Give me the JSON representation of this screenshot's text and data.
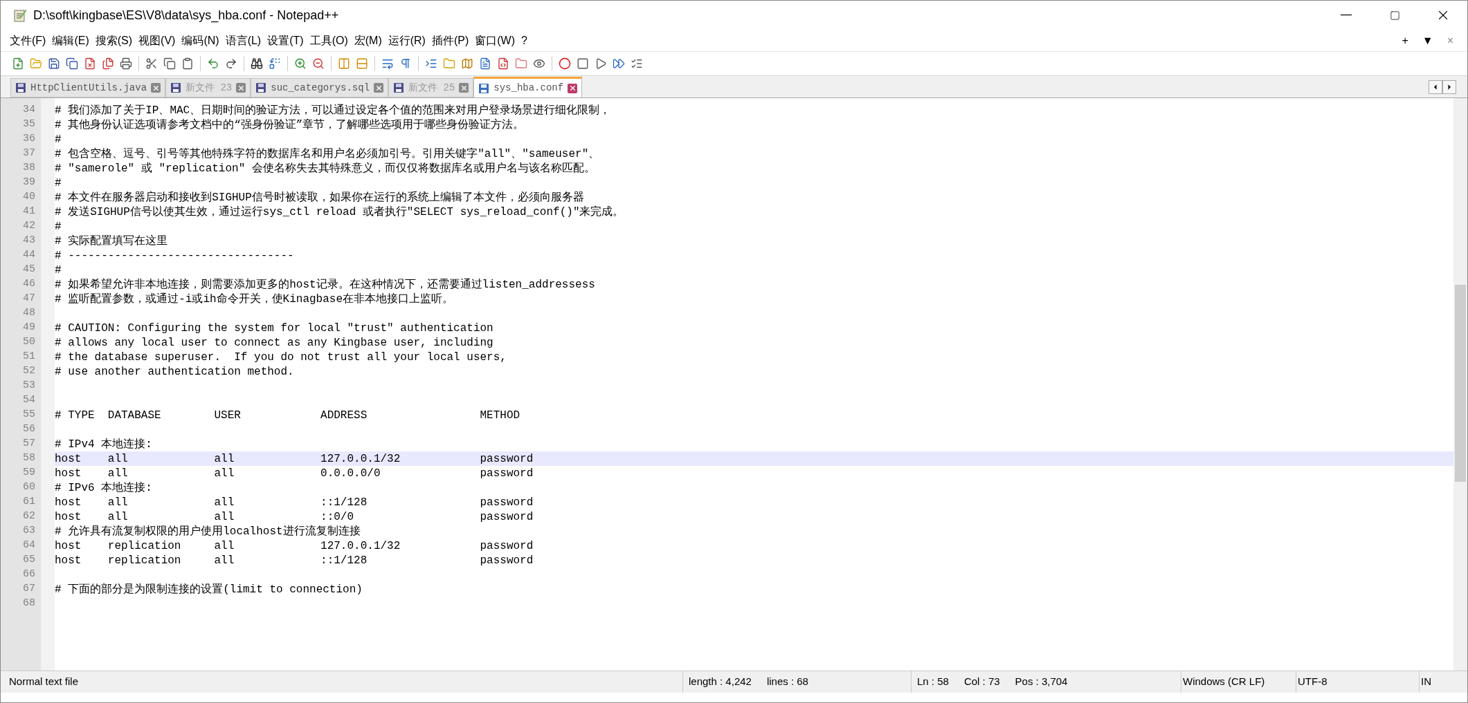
{
  "window": {
    "title": "D:\\soft\\kingbase\\ES\\V8\\data\\sys_hba.conf - Notepad++"
  },
  "menu": [
    "文件(F)",
    "编辑(E)",
    "搜索(S)",
    "视图(V)",
    "编码(N)",
    "语言(L)",
    "设置(T)",
    "工具(O)",
    "宏(M)",
    "运行(R)",
    "插件(P)",
    "窗口(W)",
    "?"
  ],
  "menu_right": [
    "+",
    "▼",
    "×"
  ],
  "tabs": [
    {
      "label": "HttpClientUtils.java",
      "selected": false,
      "dimmed": false
    },
    {
      "label": "新文件 23",
      "selected": false,
      "dimmed": true
    },
    {
      "label": "suc_categorys.sql",
      "selected": false,
      "dimmed": false
    },
    {
      "label": "新文件 25",
      "selected": false,
      "dimmed": true
    },
    {
      "label": "sys_hba.conf",
      "selected": true,
      "dimmed": false
    }
  ],
  "lines": [
    {
      "number": "34",
      "text": "# 我们添加了关于IP、MAC、日期时间的验证方法，可以通过设定各个值的范围来对用户登录场景进行细化限制，",
      "current": false
    },
    {
      "number": "35",
      "text": "# 其他身份认证选项请参考文档中的“强身份验证”章节，了解哪些选项用于哪些身份验证方法。",
      "current": false
    },
    {
      "number": "36",
      "text": "#",
      "current": false
    },
    {
      "number": "37",
      "text": "# 包含空格、逗号、引号等其他特殊字符的数据库名和用户名必须加引号。引用关键字\"all\"、\"sameuser\"、",
      "current": false
    },
    {
      "number": "38",
      "text": "# \"samerole\" 或 \"replication\" 会使名称失去其特殊意义，而仅仅将数据库名或用户名与该名称匹配。",
      "current": false
    },
    {
      "number": "39",
      "text": "#",
      "current": false
    },
    {
      "number": "40",
      "text": "# 本文件在服务器启动和接收到SIGHUP信号时被读取，如果你在运行的系统上编辑了本文件，必须向服务器",
      "current": false
    },
    {
      "number": "41",
      "text": "# 发送SIGHUP信号以使其生效，通过运行sys_ctl reload 或者执行\"SELECT sys_reload_conf()\"来完成。",
      "current": false
    },
    {
      "number": "42",
      "text": "#",
      "current": false
    },
    {
      "number": "43",
      "text": "# 实际配置填写在这里",
      "current": false
    },
    {
      "number": "44",
      "text": "# ----------------------------------",
      "current": false
    },
    {
      "number": "45",
      "text": "#",
      "current": false
    },
    {
      "number": "46",
      "text": "# 如果希望允许非本地连接，则需要添加更多的host记录。在这种情况下，还需要通过listen_addressess",
      "current": false
    },
    {
      "number": "47",
      "text": "# 监听配置参数，或通过-i或ih命令开关，使Kinagbase在非本地接口上监听。",
      "current": false
    },
    {
      "number": "48",
      "current": false
    },
    {
      "number": "49",
      "text": "# CAUTION: Configuring the system for local \"trust\" authentication",
      "current": false
    },
    {
      "number": "50",
      "text": "# allows any local user to connect as any Kingbase user, including",
      "current": false
    },
    {
      "number": "51",
      "text": "# the database superuser.  If you do not trust all your local users,",
      "current": false
    },
    {
      "number": "52",
      "text": "# use another authentication method.",
      "current": false
    },
    {
      "number": "53",
      "current": false
    },
    {
      "number": "54",
      "current": false
    },
    {
      "number": "55",
      "text": "# TYPE  DATABASE        USER            ADDRESS                 METHOD",
      "current": false
    },
    {
      "number": "56",
      "current": false
    },
    {
      "number": "57",
      "text": "# IPv4 本地连接:",
      "current": false
    },
    {
      "number": "58",
      "text": "host    all             all             127.0.0.1/32            password",
      "current": true
    },
    {
      "number": "59",
      "text": "host    all             all             0.0.0.0/0               password",
      "current": false
    },
    {
      "number": "60",
      "text": "# IPv6 本地连接:",
      "current": false
    },
    {
      "number": "61",
      "text": "host    all             all             ::1/128                 password",
      "current": false
    },
    {
      "number": "62",
      "text": "host    all             all             ::0/0                   password",
      "current": false
    },
    {
      "number": "63",
      "text": "# 允许具有流复制权限的用户使用localhost进行流复制连接",
      "current": false
    },
    {
      "number": "64",
      "text": "host    replication     all             127.0.0.1/32            password",
      "current": false
    },
    {
      "number": "65",
      "text": "host    replication     all             ::1/128                 password",
      "current": false
    },
    {
      "number": "66",
      "current": false
    },
    {
      "number": "67",
      "text": "# 下面的部分是为限制连接的设置(limit to connection)",
      "current": false
    },
    {
      "number": "68",
      "current": false
    }
  ],
  "status_bar": {
    "file_type": "Normal text file",
    "length": "length : 4,242",
    "lines": "lines : 68",
    "ln": "Ln : 58",
    "col": "Col : 73",
    "pos": "Pos : 3,704",
    "eol": "Windows (CR LF)",
    "encoding": "UTF-8",
    "mode": "IN"
  }
}
